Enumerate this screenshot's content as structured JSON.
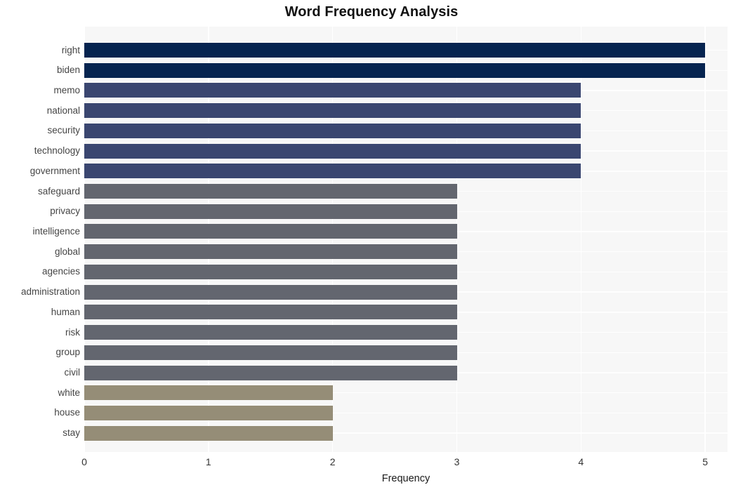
{
  "chart_data": {
    "type": "bar",
    "orientation": "horizontal",
    "title": "Word Frequency Analysis",
    "xlabel": "Frequency",
    "ylabel": "",
    "xlim": [
      0,
      5.18
    ],
    "xticks": [
      0,
      1,
      2,
      3,
      4,
      5
    ],
    "xtick_labels": [
      "0",
      "1",
      "2",
      "3",
      "4",
      "5"
    ],
    "grid": true,
    "grid_color": "#ffffff",
    "plot_background": "#f7f7f7",
    "legend": null,
    "categories": [
      "right",
      "biden",
      "memo",
      "national",
      "security",
      "technology",
      "government",
      "safeguard",
      "privacy",
      "intelligence",
      "global",
      "agencies",
      "administration",
      "human",
      "risk",
      "group",
      "civil",
      "white",
      "house",
      "stay"
    ],
    "values": [
      5,
      5,
      4,
      4,
      4,
      4,
      4,
      3,
      3,
      3,
      3,
      3,
      3,
      3,
      3,
      3,
      3,
      2,
      2,
      2
    ],
    "bar_colors": [
      "#062450",
      "#062450",
      "#3a4670",
      "#3a4670",
      "#3a4670",
      "#3a4670",
      "#3a4670",
      "#63666f",
      "#63666f",
      "#63666f",
      "#63666f",
      "#63666f",
      "#63666f",
      "#63666f",
      "#63666f",
      "#63666f",
      "#63666f",
      "#958d77",
      "#958d77",
      "#958d77"
    ],
    "palette": {
      "navy": "#062450",
      "slate_blue": "#3a4670",
      "gray": "#63666f",
      "khaki": "#958d77"
    }
  }
}
